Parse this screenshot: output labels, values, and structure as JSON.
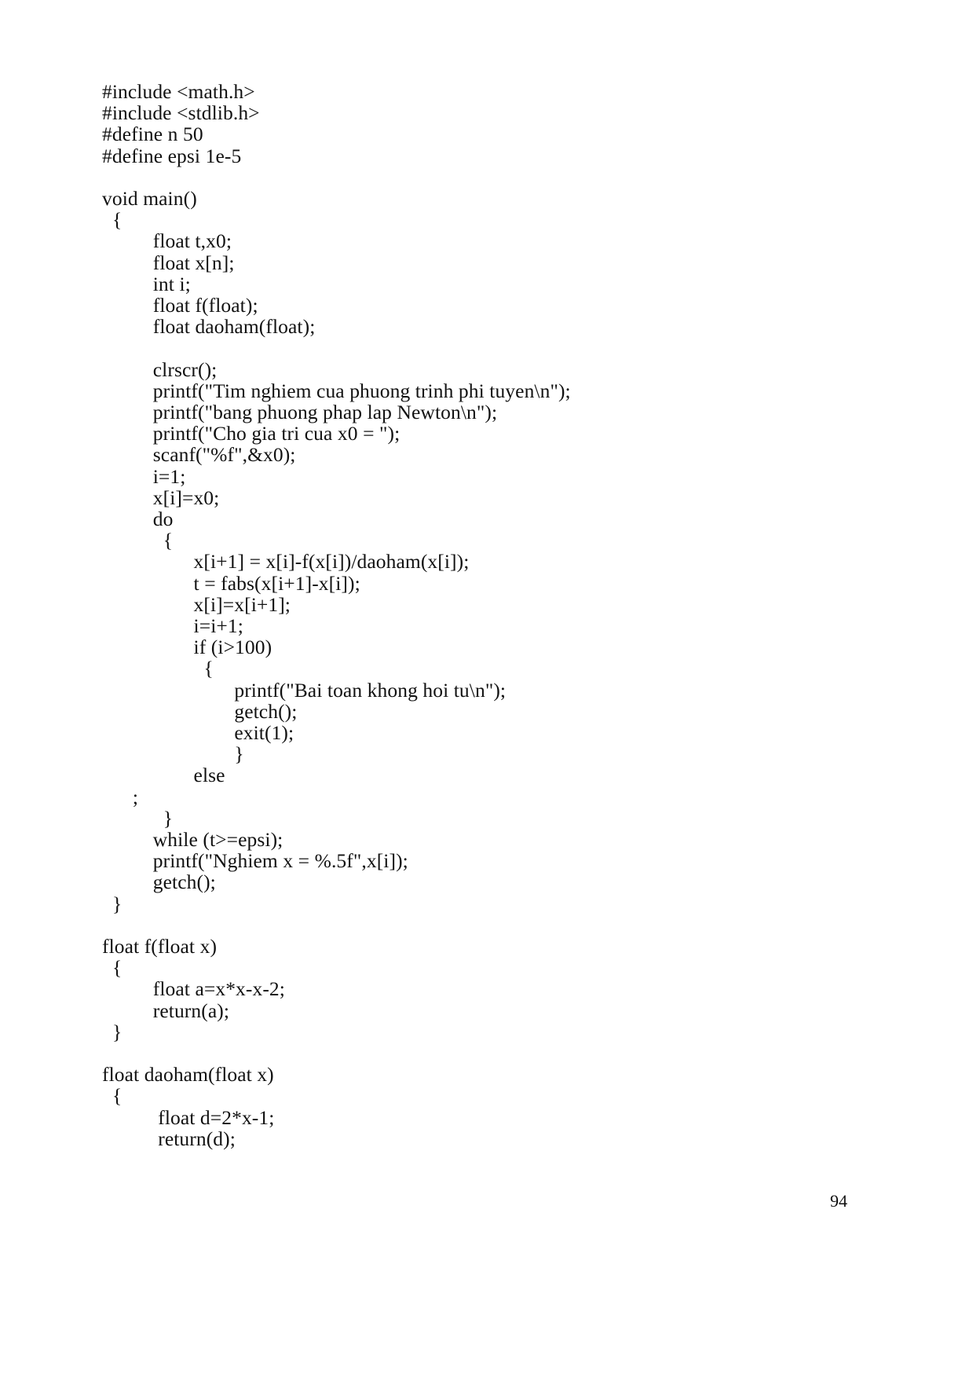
{
  "document": {
    "type": "printed-page-scan",
    "page_number": "94",
    "background_color": "#ffffff",
    "text_color": "#111111",
    "code_language": "C"
  },
  "code": {
    "lines": [
      "#include <math.h>",
      "#include <stdlib.h>",
      "#define n 50",
      "#define epsi 1e-5",
      "",
      "void main()",
      "  {",
      "          float t,x0;",
      "          float x[n];",
      "          int i;",
      "          float f(float);",
      "          float daoham(float);",
      "",
      "          clrscr();",
      "          printf(\"Tim nghiem cua phuong trinh phi tuyen\\n\");",
      "          printf(\"bang phuong phap lap Newton\\n\");",
      "          printf(\"Cho gia tri cua x0 = \");",
      "          scanf(\"%f\",&x0);",
      "          i=1;",
      "          x[i]=x0;",
      "          do",
      "            {",
      "                  x[i+1] = x[i]-f(x[i])/daoham(x[i]);",
      "                  t = fabs(x[i+1]-x[i]);",
      "                  x[i]=x[i+1];",
      "                  i=i+1;",
      "                  if (i>100)",
      "                    {",
      "                          printf(\"Bai toan khong hoi tu\\n\");",
      "                          getch();",
      "                          exit(1);",
      "                          }",
      "                  else",
      "      ;",
      "            }",
      "          while (t>=epsi);",
      "          printf(\"Nghiem x = %.5f\",x[i]);",
      "          getch();",
      "  }",
      "",
      "float f(float x)",
      "  {",
      "          float a=x*x-x-2;",
      "          return(a);",
      "  }",
      "",
      "float daoham(float x)",
      "  {",
      "           float d=2*x-1;",
      "           return(d);"
    ]
  }
}
